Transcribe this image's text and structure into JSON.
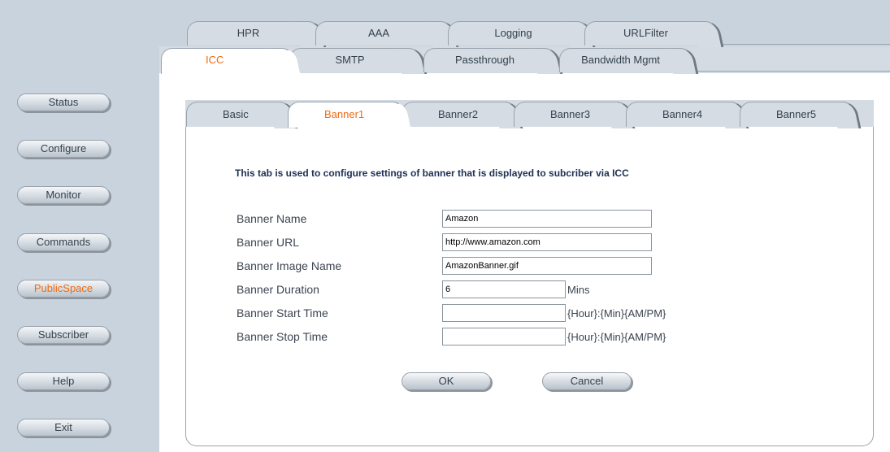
{
  "sidebar": {
    "items": [
      {
        "label": "Status",
        "active": false
      },
      {
        "label": "Configure",
        "active": false
      },
      {
        "label": "Monitor",
        "active": false
      },
      {
        "label": "Commands",
        "active": false
      },
      {
        "label": "PublicSpace",
        "active": true
      },
      {
        "label": "Subscriber",
        "active": false
      },
      {
        "label": "Help",
        "active": false
      },
      {
        "label": "Exit",
        "active": false
      }
    ]
  },
  "main_tabs": {
    "row1": [
      "HPR",
      "AAA",
      "Logging",
      "URLFilter"
    ],
    "row2": [
      "ICC",
      "SMTP",
      "Passthrough",
      "Bandwidth Mgmt"
    ],
    "selected": "ICC"
  },
  "sub_tabs": {
    "items": [
      "Basic",
      "Banner1",
      "Banner2",
      "Banner3",
      "Banner4",
      "Banner5"
    ],
    "selected": "Banner1"
  },
  "form": {
    "description": "This tab is used to configure settings of banner that is displayed to subcriber via ICC",
    "fields": [
      {
        "label": "Banner Name",
        "value": "Amazon",
        "unit": ""
      },
      {
        "label": "Banner URL",
        "value": "http://www.amazon.com",
        "unit": ""
      },
      {
        "label": "Banner Image Name",
        "value": "AmazonBanner.gif",
        "unit": ""
      },
      {
        "label": "Banner Duration",
        "value": "6",
        "unit": "Mins"
      },
      {
        "label": "Banner Start Time",
        "value": "",
        "unit": "{Hour}:{Min}{AM/PM}"
      },
      {
        "label": "Banner Stop Time",
        "value": "",
        "unit": "{Hour}:{Min}{AM/PM}"
      }
    ],
    "ok_label": "OK",
    "cancel_label": "Cancel"
  },
  "colors": {
    "accent": "#ef6b12",
    "sidebar_bg": "#c9d3dd",
    "heading": "#1d2f53"
  }
}
